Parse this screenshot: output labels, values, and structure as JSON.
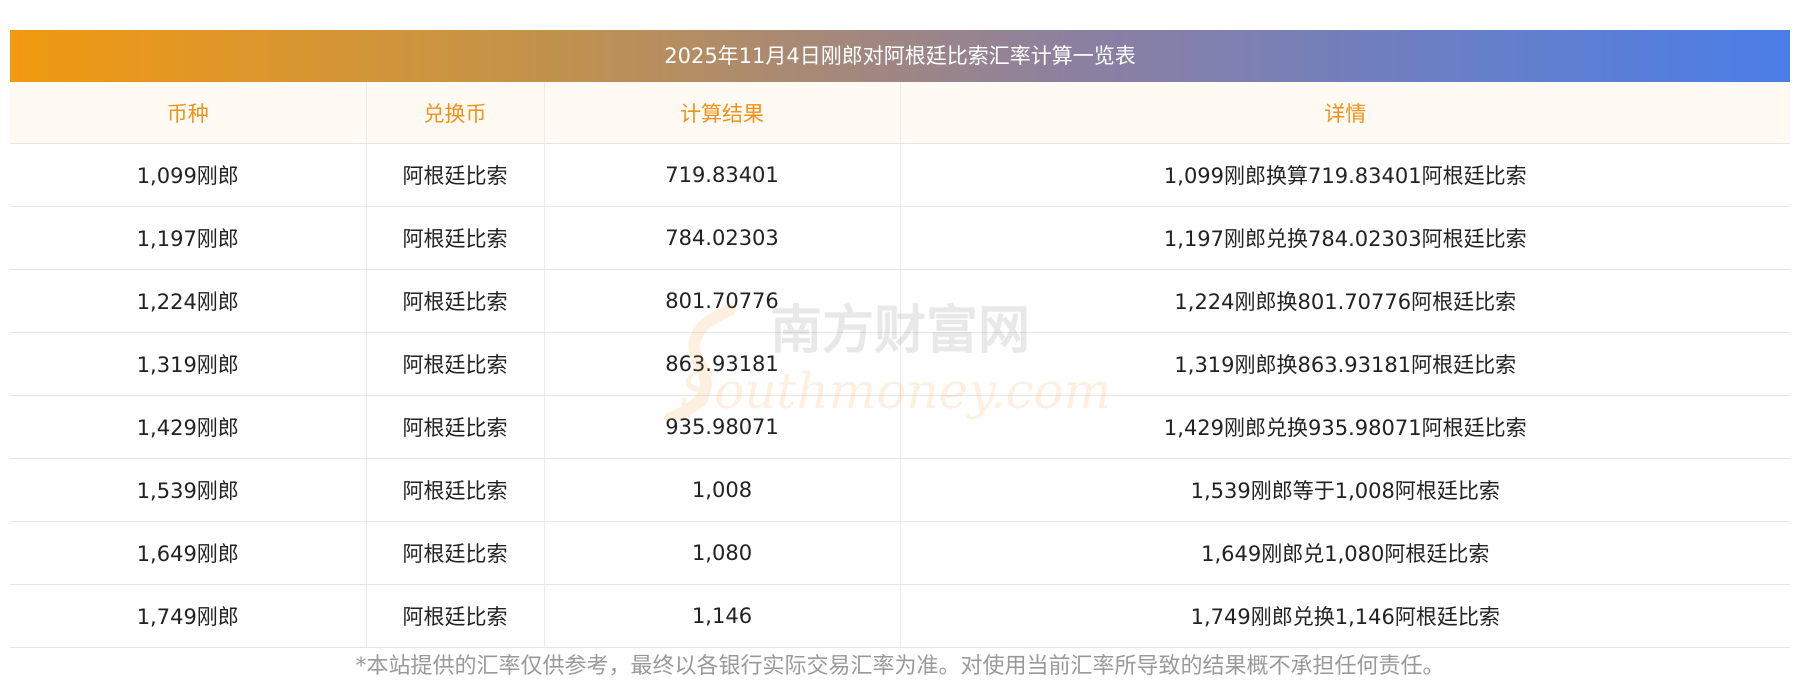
{
  "title": "2025年11月4日刚郎对阿根廷比索汇率计算一览表",
  "columns": [
    "币种",
    "兑换币",
    "计算结果",
    "详情"
  ],
  "rows": [
    [
      "1,099刚郎",
      "阿根廷比索",
      "719.83401",
      "1,099刚郎换算719.83401阿根廷比索"
    ],
    [
      "1,197刚郎",
      "阿根廷比索",
      "784.02303",
      "1,197刚郎兑换784.02303阿根廷比索"
    ],
    [
      "1,224刚郎",
      "阿根廷比索",
      "801.70776",
      "1,224刚郎换801.70776阿根廷比索"
    ],
    [
      "1,319刚郎",
      "阿根廷比索",
      "863.93181",
      "1,319刚郎换863.93181阿根廷比索"
    ],
    [
      "1,429刚郎",
      "阿根廷比索",
      "935.98071",
      "1,429刚郎兑换935.98071阿根廷比索"
    ],
    [
      "1,539刚郎",
      "阿根廷比索",
      "1,008",
      "1,539刚郎等于1,008阿根廷比索"
    ],
    [
      "1,649刚郎",
      "阿根廷比索",
      "1,080",
      "1,649刚郎兑1,080阿根廷比索"
    ],
    [
      "1,749刚郎",
      "阿根廷比索",
      "1,146",
      "1,749刚郎兑换1,146阿根廷比索"
    ]
  ],
  "watermark": {
    "cn": "南方财富网",
    "en": "Southmoney.com"
  },
  "footnote": "*本站提供的汇率仅供参考，最终以各银行实际交易汇率为准。对使用当前汇率所导致的结果概不承担任何责任。"
}
